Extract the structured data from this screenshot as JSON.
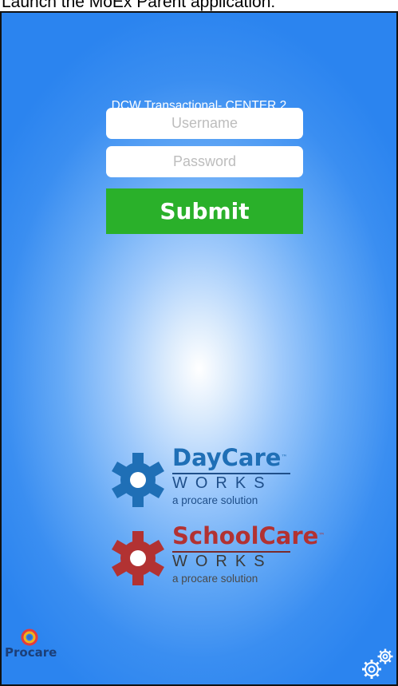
{
  "caption": "Launch the MoEx Parent application:",
  "login": {
    "school_title": "DCW Transactional- CENTER 2",
    "username_placeholder": "Username",
    "password_placeholder": "Password",
    "submit_label": "Submit"
  },
  "brands": {
    "daycare": {
      "name": "DayCare",
      "works": "WORKS",
      "tagline": "a procare solution"
    },
    "schoolcare": {
      "name": "SchoolCare",
      "works": "WORKS",
      "tagline": "a procare solution"
    }
  },
  "footer": {
    "procare_label": "Procare"
  },
  "colors": {
    "submit_green": "#2ab02a",
    "daycare_blue": "#1f6fb6",
    "schoolcare_red": "#b23232",
    "background_blue": "#2b84ef"
  },
  "icons": {
    "settings": "gears-icon",
    "procare": "procare-logo-icon"
  }
}
